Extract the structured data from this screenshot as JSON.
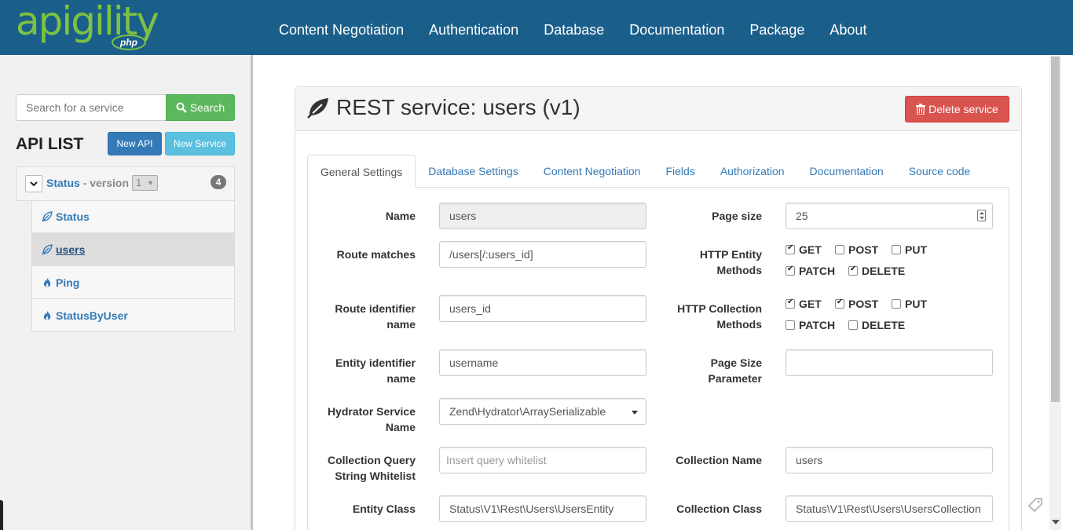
{
  "brand": {
    "logo_text": "apigility",
    "logo_sub": "php"
  },
  "nav": [
    "Content Negotiation",
    "Authentication",
    "Database",
    "Documentation",
    "Package",
    "About"
  ],
  "sidebar": {
    "search_placeholder": "Search for a service",
    "search_label": "Search",
    "api_list_title": "API LIST",
    "new_api_label": "New API",
    "new_service_label": "New Service",
    "api": {
      "name": "Status",
      "version_text": "- version",
      "version_value": "1",
      "service_count": "4"
    },
    "services": [
      {
        "label": "Status",
        "type": "rest"
      },
      {
        "label": "users",
        "type": "rest",
        "active": true
      },
      {
        "label": "Ping",
        "type": "rpc"
      },
      {
        "label": "StatusByUser",
        "type": "rpc"
      }
    ]
  },
  "panel": {
    "title": "REST service: users (v1)",
    "delete_label": "Delete service",
    "tabs": [
      "General Settings",
      "Database Settings",
      "Content Negotiation",
      "Fields",
      "Authorization",
      "Documentation",
      "Source code"
    ],
    "active_tab": "General Settings"
  },
  "form": {
    "name_label": "Name",
    "name_value": "users",
    "route_matches_label": "Route matches",
    "route_matches_value": "/users[/:users_id]",
    "route_identifier_label_1": "Route identifier",
    "route_identifier_label_2": "name",
    "route_identifier_value": "users_id",
    "entity_identifier_label_1": "Entity identifier",
    "entity_identifier_label_2": "name",
    "entity_identifier_value": "username",
    "hydrator_label_1": "Hydrator Service",
    "hydrator_label_2": "Name",
    "hydrator_value": "Zend\\Hydrator\\ArraySerializable",
    "collection_query_label_1": "Collection Query",
    "collection_query_label_2": "String Whitelist",
    "collection_query_placeholder": "Insert query whitelist",
    "entity_class_label": "Entity Class",
    "entity_class_value": "Status\\V1\\Rest\\Users\\UsersEntity",
    "page_size_label": "Page size",
    "page_size_value": "25",
    "http_entity_label_1": "HTTP Entity",
    "http_entity_label_2": "Methods",
    "http_entity_methods": [
      {
        "label": "GET",
        "checked": true
      },
      {
        "label": "POST",
        "checked": false
      },
      {
        "label": "PUT",
        "checked": false
      },
      {
        "label": "PATCH",
        "checked": true
      },
      {
        "label": "DELETE",
        "checked": true
      }
    ],
    "http_collection_label_1": "HTTP Collection",
    "http_collection_label_2": "Methods",
    "http_collection_methods": [
      {
        "label": "GET",
        "checked": true
      },
      {
        "label": "POST",
        "checked": true
      },
      {
        "label": "PUT",
        "checked": false
      },
      {
        "label": "PATCH",
        "checked": false
      },
      {
        "label": "DELETE",
        "checked": false
      }
    ],
    "page_size_param_label_1": "Page Size",
    "page_size_param_label_2": "Parameter",
    "page_size_param_value": "",
    "collection_name_label": "Collection Name",
    "collection_name_value": "users",
    "collection_class_label": "Collection Class",
    "collection_class_value": "Status\\V1\\Rest\\Users\\UsersCollection"
  }
}
